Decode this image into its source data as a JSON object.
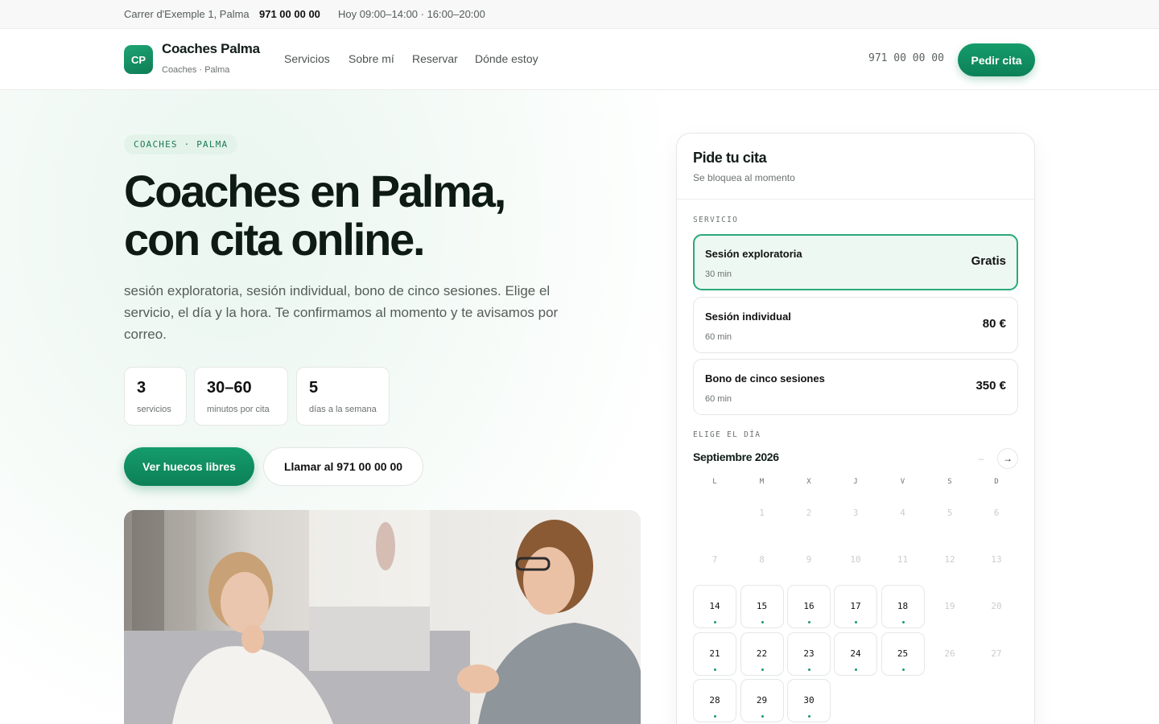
{
  "topbar": {
    "address": "Carrer d'Exemple 1, Palma",
    "phone": "971 00 00 00",
    "hours": "Hoy 09:00–14:00 · 16:00–20:00"
  },
  "header": {
    "logo": "CP",
    "brand": "Coaches Palma",
    "brand_sub": "Coaches · Palma",
    "nav": [
      "Servicios",
      "Sobre mí",
      "Reservar",
      "Dónde estoy"
    ],
    "phone": "971 00 00 00",
    "cta": "Pedir cita"
  },
  "hero": {
    "pill": "COACHES · PALMA",
    "title_line1": "Coaches en Palma,",
    "title_line2": "con cita online.",
    "description": "sesión exploratoria, sesión individual, bono de cinco sesiones. Elige el servicio, el día y la hora. Te confirmamos al momento y te avisamos por correo.",
    "stats": [
      {
        "value": "3",
        "label": "servicios"
      },
      {
        "value": "30–60",
        "label": "minutos por cita"
      },
      {
        "value": "5",
        "label": "días a la semana"
      }
    ],
    "primary_button": "Ver huecos libres",
    "secondary_button": "Llamar al 971 00 00 00"
  },
  "booking": {
    "title": "Pide tu cita",
    "subtitle": "Se bloquea al momento",
    "service_label": "SERVICIO",
    "services": [
      {
        "name": "Sesión exploratoria",
        "duration": "30 min",
        "price": "Gratis",
        "selected": true
      },
      {
        "name": "Sesión individual",
        "duration": "60 min",
        "price": "80 €",
        "selected": false
      },
      {
        "name": "Bono de cinco sesiones",
        "duration": "60 min",
        "price": "350 €",
        "selected": false
      }
    ],
    "day_label": "ELIGE EL DÍA",
    "month": "Septiembre 2026",
    "prev_icon": "–",
    "next_icon": "→",
    "weekdays": [
      "L",
      "M",
      "X",
      "J",
      "V",
      "S",
      "D"
    ],
    "calendar_weeks": [
      [
        "",
        "1",
        "2",
        "3",
        "4",
        "5",
        "6"
      ],
      [
        "7",
        "8",
        "9",
        "10",
        "11",
        "12",
        "13"
      ],
      [
        "14",
        "15",
        "16",
        "17",
        "18",
        "19",
        "20"
      ],
      [
        "21",
        "22",
        "23",
        "24",
        "25",
        "26",
        "27"
      ],
      [
        "28",
        "29",
        "30",
        "",
        "",
        "",
        ""
      ]
    ],
    "available_days": [
      "14",
      "15",
      "16",
      "17",
      "18",
      "21",
      "22",
      "23",
      "24",
      "25",
      "28",
      "29",
      "30"
    ]
  },
  "colors": {
    "accent": "#159c6b",
    "accent_dark": "#0c8058",
    "text": "#0e1a14",
    "muted": "#6b726e"
  }
}
